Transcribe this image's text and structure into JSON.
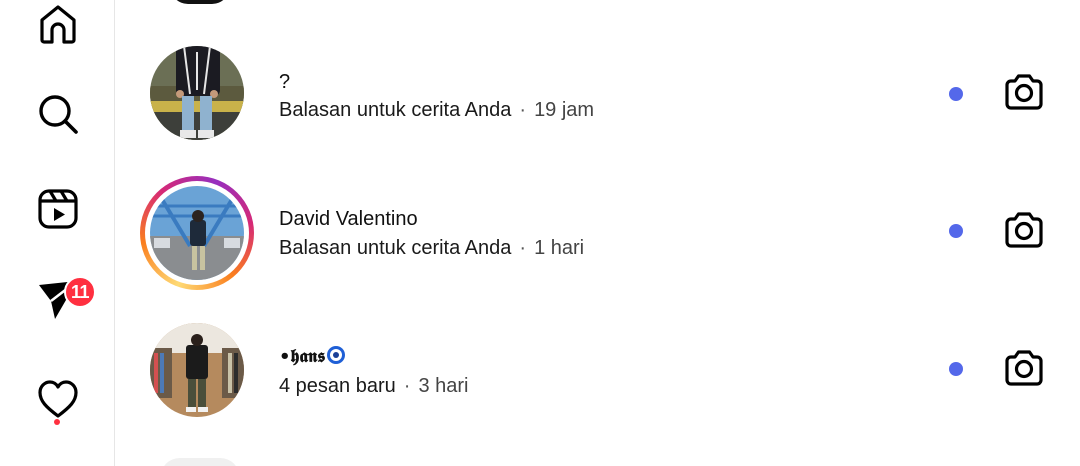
{
  "nav": {
    "items": [
      {
        "name": "home",
        "icon": "home-icon"
      },
      {
        "name": "search",
        "icon": "search-icon"
      },
      {
        "name": "reels",
        "icon": "reels-icon"
      },
      {
        "name": "direct",
        "icon": "paper-plane-icon",
        "badge": "11"
      },
      {
        "name": "activity",
        "icon": "heart-icon"
      }
    ],
    "badge_color": "#ff3040"
  },
  "conversations": [
    {
      "name": "?",
      "preview": "Balasan untuk cerita Anda",
      "separator": "·",
      "time": "19 jam",
      "has_story_ring": false,
      "unread": true
    },
    {
      "name": "David Valentino",
      "preview": "Balasan untuk cerita Anda",
      "separator": "·",
      "time": "1 hari",
      "has_story_ring": true,
      "unread": true
    },
    {
      "name": "•𝖍𝖆𝖓𝖘",
      "name_emoji": "nazar-amulet",
      "preview": "4 pesan baru",
      "separator": "·",
      "time": "3 hari",
      "has_story_ring": false,
      "unread": true
    }
  ],
  "unread_dot_color": "#5468ea"
}
